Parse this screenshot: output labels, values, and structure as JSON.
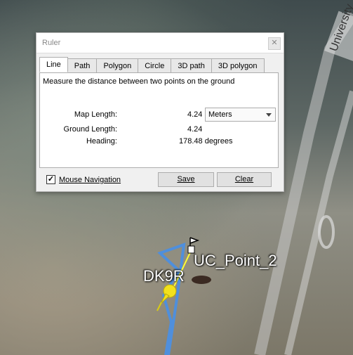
{
  "dialog": {
    "title": "Ruler",
    "close_symbol": "✕",
    "tabs": [
      {
        "label": "Line",
        "active": true
      },
      {
        "label": "Path",
        "active": false
      },
      {
        "label": "Polygon",
        "active": false
      },
      {
        "label": "Circle",
        "active": false
      },
      {
        "label": "3D path",
        "active": false
      },
      {
        "label": "3D polygon",
        "active": false
      }
    ],
    "description": "Measure the distance between two points on the ground",
    "map_length_label": "Map Length:",
    "map_length_value": "4.24",
    "units_selected": "Meters",
    "ground_length_label": "Ground Length:",
    "ground_length_value": "4.24",
    "heading_label": "Heading:",
    "heading_value": "178.48 degrees",
    "mouse_navigation_label": "Mouse Navigation",
    "mouse_navigation_checked": true,
    "checkbox_mark": "✓",
    "save_label": "Save",
    "clear_label": "Clear"
  },
  "map": {
    "street_label": "University",
    "placemark_1": "UC_Point_2",
    "placemark_2": "DK9R",
    "path_color": "#4f8fdc",
    "ruler_line_color": "#ffff33",
    "pin_color": "#f2e11c"
  }
}
